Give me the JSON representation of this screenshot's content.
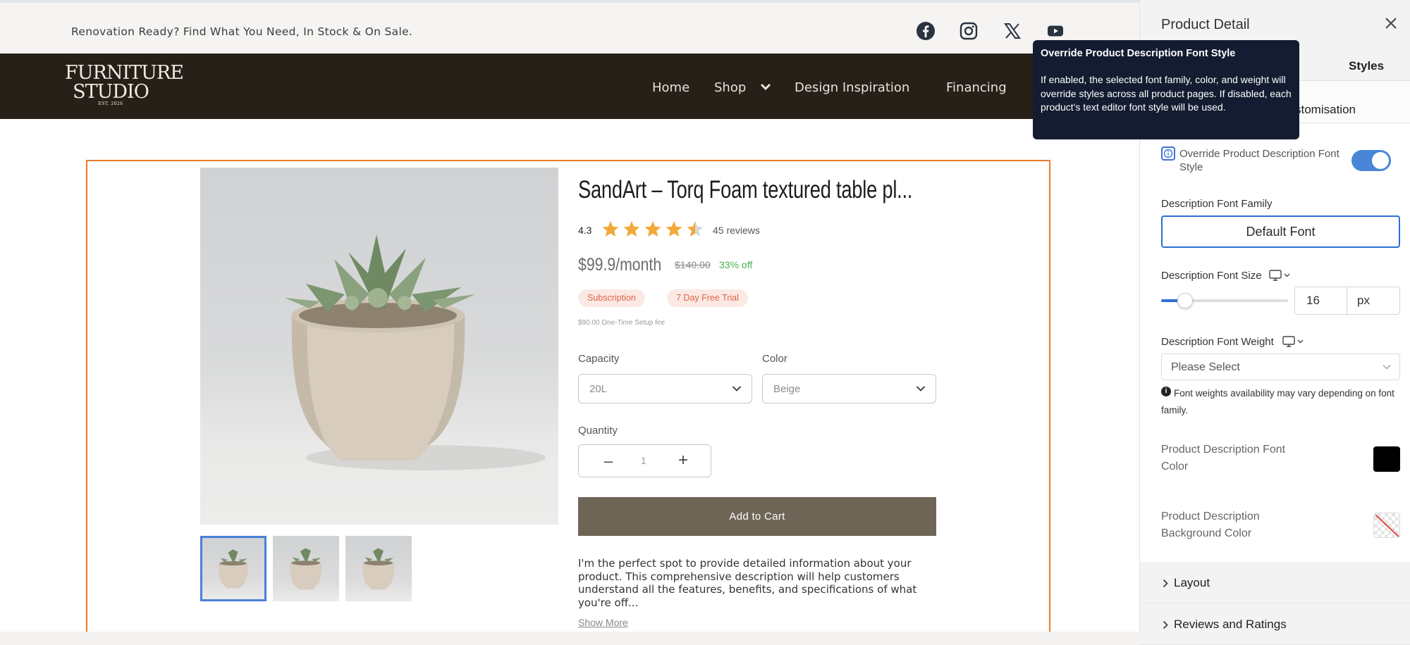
{
  "announcement": "Renovation Ready? Find What You Need, In Stock & On Sale.",
  "social_icons": [
    "facebook-icon",
    "instagram-icon",
    "x-icon",
    "youtube-icon"
  ],
  "logo": {
    "line1": "FURNITURE",
    "line2": "STUDIO",
    "line3": "EST. 2026"
  },
  "nav": {
    "home": "Home",
    "shop": "Shop",
    "design": "Design Inspiration",
    "financing": "Financing"
  },
  "product": {
    "title": "SandArt – Torq Foam textured table pl...",
    "rating": "4.3",
    "stars": 4.5,
    "reviews": "45 reviews",
    "price": "$99.9/month",
    "old_price": "$140.00",
    "discount": "33% off",
    "pill_subscription": "Subscription",
    "pill_trial": "7 Day Free Trial",
    "setup_fee": "$90.00 One-Time Setup fee",
    "capacity_label": "Capacity",
    "capacity_value": "20L",
    "color_label": "Color",
    "color_value": "Beige",
    "quantity_label": "Quantity",
    "quantity_value": "1",
    "minus": "–",
    "plus": "+",
    "add_to_cart": "Add to Cart",
    "description": "I'm the perfect spot to provide detailed information about your product. This comprehensive description will help customers understand all the features, benefits, and specifications of what you're off...",
    "show_more": "Show More"
  },
  "tooltip": {
    "title": "Override Product Description Font Style",
    "body": "If enabled, the selected font family, color, and weight will override styles across all product pages. If disabled, each product's text editor font style will be used."
  },
  "panel": {
    "title": "Product Detail",
    "tab_styles": "Styles",
    "section_head": "stomisation",
    "override_label": "Override Product Description Font Style",
    "override_enabled": true,
    "font_family_label": "Description Font Family",
    "font_family_value": "Default Font",
    "font_size_label": "Description Font Size",
    "font_size_value": "16",
    "font_size_unit": "px",
    "font_weight_label": "Description Font Weight",
    "font_weight_placeholder": "Please Select",
    "font_weight_note": "Font weights availability may vary depending on font family.",
    "font_color_label": "Product Description Font Color",
    "font_color": "#000000",
    "bg_color_label": "Product Description Background Color",
    "layout": "Layout",
    "reviews_ratings": "Reviews and Ratings"
  },
  "colors": {
    "accent": "#2d6fd6",
    "nav_bg": "#262019",
    "cart_button": "#6f6556",
    "widget_border": "#e87c2c",
    "tooltip_bg": "#131c30"
  }
}
